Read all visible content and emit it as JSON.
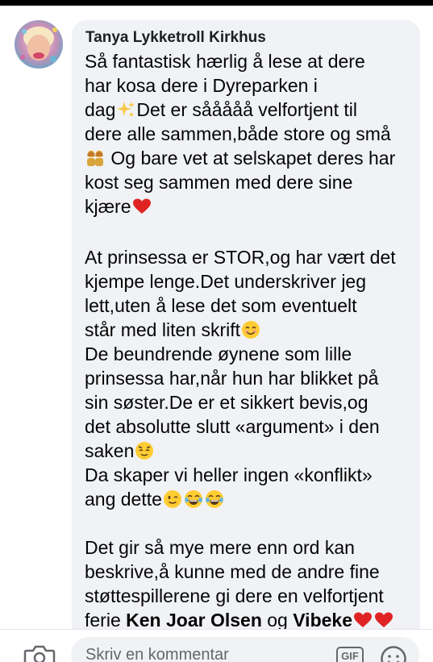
{
  "comment": {
    "author": "Tanya Lykketroll Kirkhus",
    "lines": [
      "Så fantastisk hærlig å lese at dere",
      "har kosa dere i Dyreparken i",
      "dag",
      "Det er sååååå velfortjent til",
      "dere alle sammen,både store og små",
      " Og bare vet at selskapet deres har",
      "kost seg sammen med dere sine",
      "kjære",
      "At prinsessa er STOR,og har vært det",
      "kjempe lenge.Det underskriver jeg",
      "lett,uten å lese det som eventuelt",
      "står med liten skrift",
      "De beundrende øynene som lille",
      "prinsessa har,når hun har blikket på",
      "sin søster.De er et sikkert bevis,og",
      "det absolutte slutt «argument» i den",
      "saken",
      "Da skaper vi heller ingen «konflikt»",
      "ang dette",
      "Det gir så mye mere enn ord kan",
      "beskrive,å kunne med de andre fine",
      "støttespillerene gi dere en velfortjent",
      "ferie ",
      "Ken Joar Olsen",
      " og ",
      "Vibeke"
    ],
    "emoji_names": [
      "sparkles",
      "two-women",
      "red-heart",
      "smiling-face",
      "relieved-face",
      "winking-face",
      "tears-of-joy"
    ]
  },
  "composer": {
    "placeholder": "Skriv en kommentar",
    "gif_label": "GIF"
  },
  "colors": {
    "bubble": "#f0f2f5",
    "text": "#050505",
    "icon": "#65676b",
    "heart": "#e02424"
  }
}
